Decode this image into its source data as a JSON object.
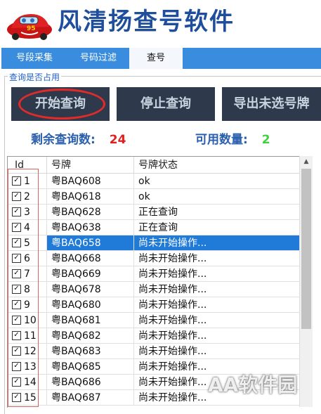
{
  "app": {
    "title": "风清扬查号软件"
  },
  "tabs": [
    {
      "label": "号段采集"
    },
    {
      "label": "号码过滤"
    },
    {
      "label": "查号"
    }
  ],
  "group": {
    "label": "查询是否占用"
  },
  "buttons": {
    "start": "开始查询",
    "stop": "停止查询",
    "export": "导出未选号牌"
  },
  "stats": {
    "remaining_label": "剩余查询数:",
    "remaining_value": "24",
    "available_label": "可用数量:",
    "available_value": "2",
    "remaining_color": "#e02020",
    "available_color": "#3ad43a"
  },
  "grid": {
    "columns": [
      "Id",
      "号牌",
      "号牌状态"
    ],
    "rows": [
      {
        "id": "1",
        "plate": "粤BAQ608",
        "status": "ok"
      },
      {
        "id": "2",
        "plate": "粤BAQ618",
        "status": "ok"
      },
      {
        "id": "3",
        "plate": "粤BAQ628",
        "status": "正在查询"
      },
      {
        "id": "4",
        "plate": "粤BAQ638",
        "status": "正在查询"
      },
      {
        "id": "5",
        "plate": "粤BAQ658",
        "status": "尚未开始操作..."
      },
      {
        "id": "6",
        "plate": "粤BAQ668",
        "status": "尚未开始操作..."
      },
      {
        "id": "7",
        "plate": "粤BAQ669",
        "status": "尚未开始操作..."
      },
      {
        "id": "8",
        "plate": "粤BAQ678",
        "status": "尚未开始操作..."
      },
      {
        "id": "9",
        "plate": "粤BAQ680",
        "status": "尚未开始操作..."
      },
      {
        "id": "10",
        "plate": "粤BAQ681",
        "status": "尚未开始操作..."
      },
      {
        "id": "11",
        "plate": "粤BAQ682",
        "status": "尚未开始操作..."
      },
      {
        "id": "12",
        "plate": "粤BAQ683",
        "status": "尚未开始操作..."
      },
      {
        "id": "13",
        "plate": "粤BAQ685",
        "status": "尚未开始操作..."
      },
      {
        "id": "14",
        "plate": "粤BAQ686",
        "status": "尚未开始操作..."
      },
      {
        "id": "15",
        "plate": "粤BAQ687",
        "status": "尚未开始操作..."
      }
    ],
    "selected_row": "5"
  },
  "watermark": "AA软件园",
  "colors": {
    "accent": "#3a8dde",
    "button_bg": "#2e3a4c",
    "title": "#1f4f9c",
    "selection": "#1f7ad8"
  }
}
